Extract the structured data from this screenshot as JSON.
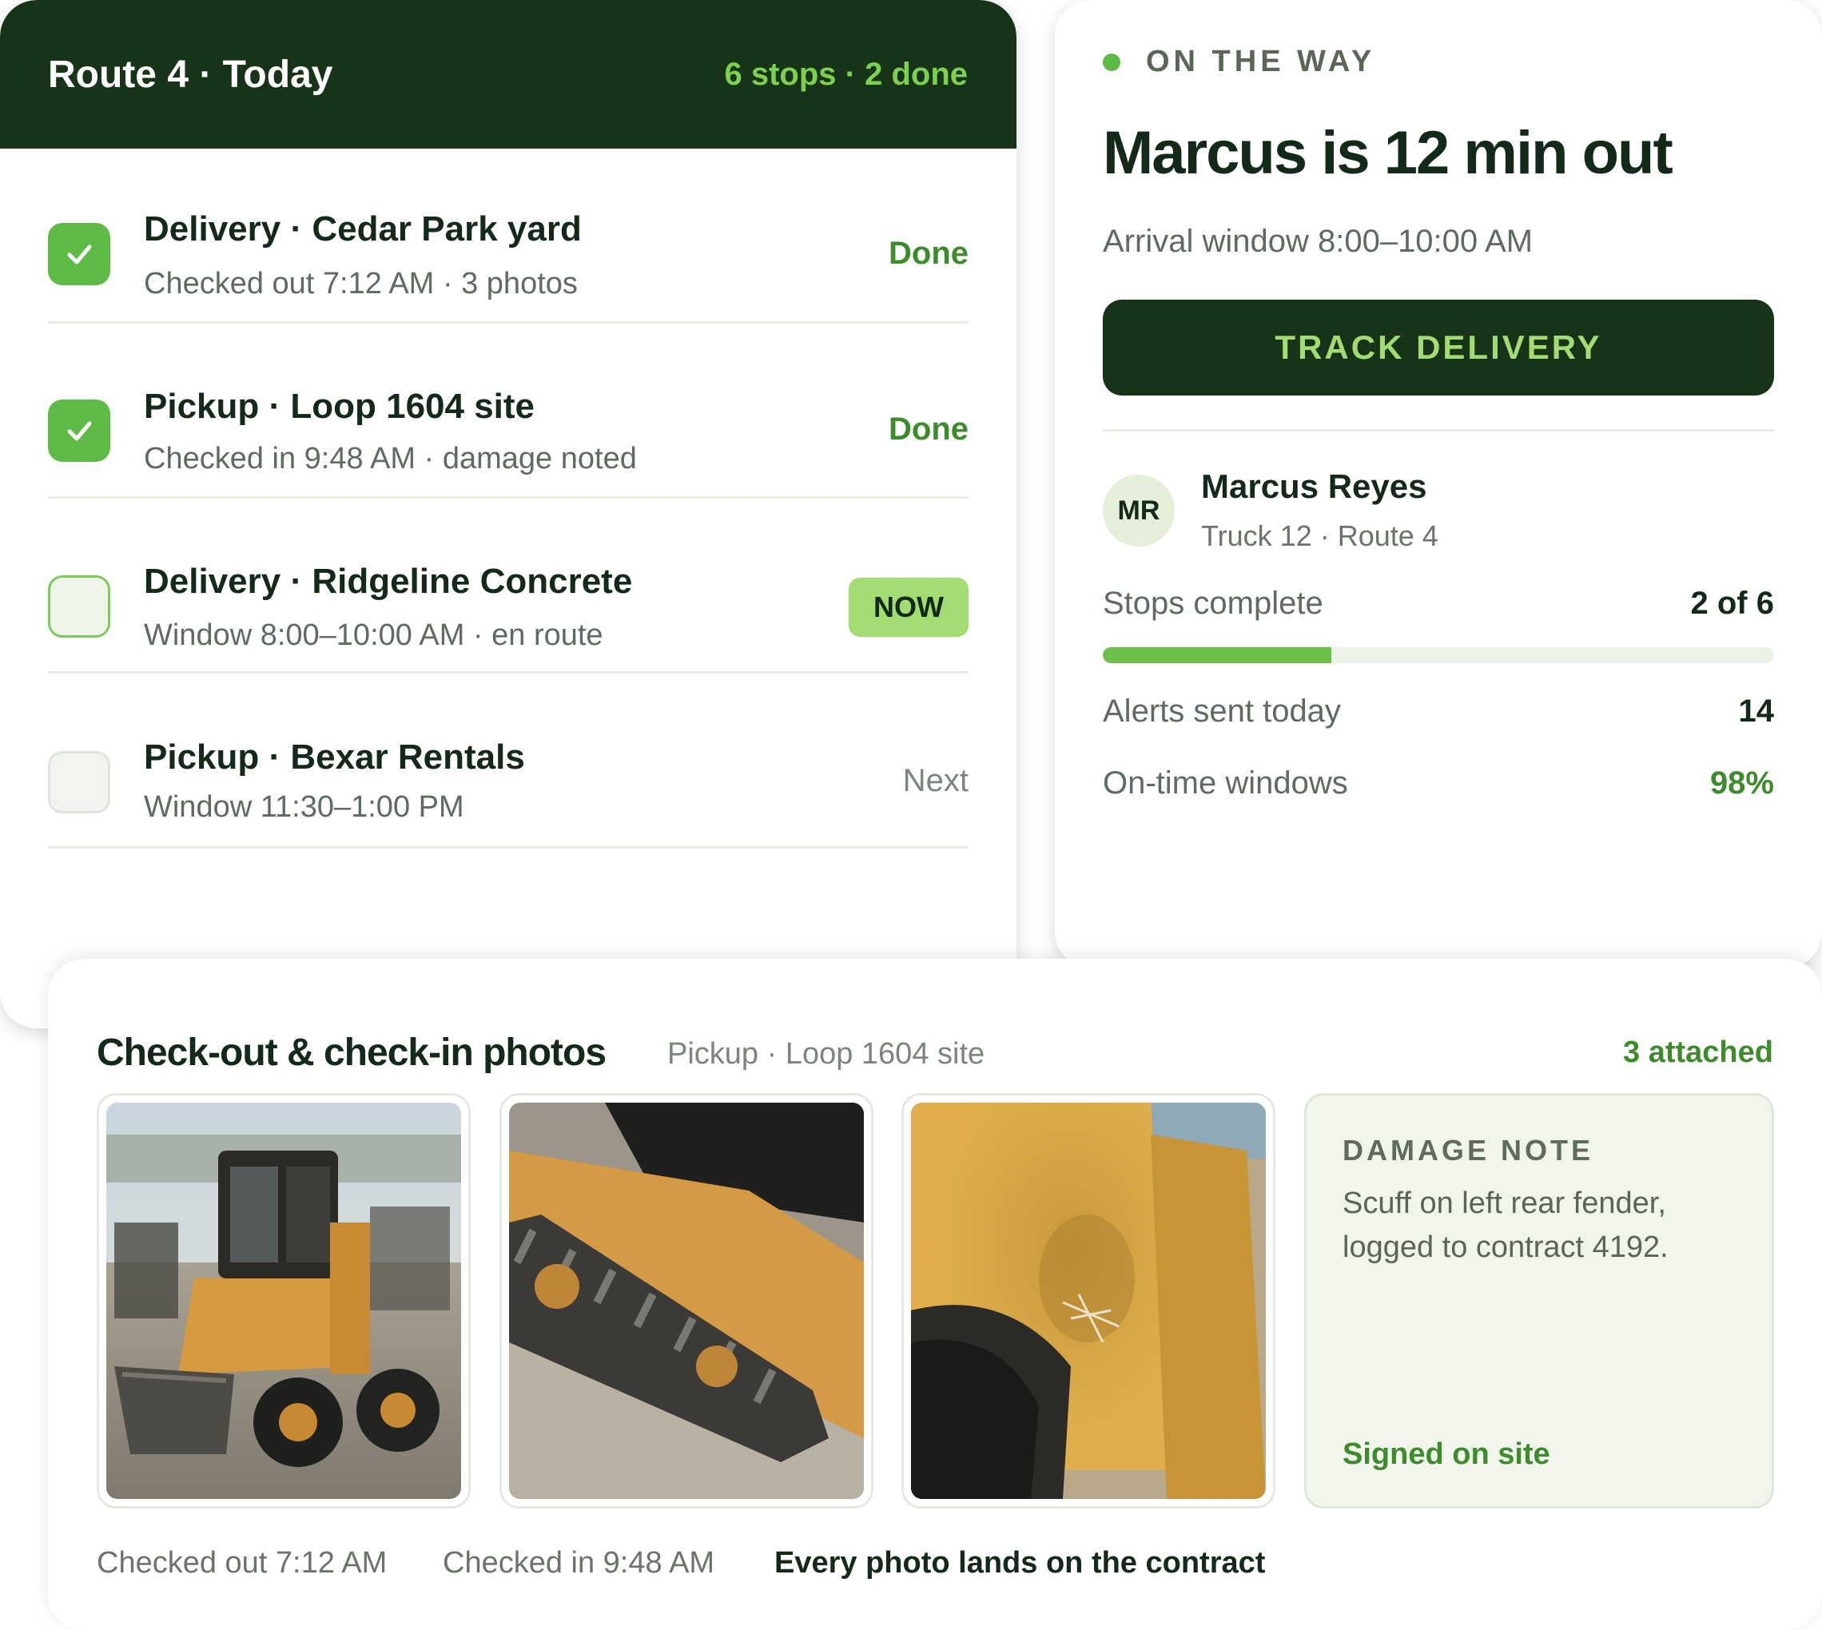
{
  "route": {
    "title": "Route 4 · Today",
    "summary": "6 stops · 2 done",
    "stops": [
      {
        "title": "Delivery · Cedar Park yard",
        "subtitle": "Checked out 7:12 AM · 3 photos",
        "status": "Done",
        "state": "done"
      },
      {
        "title": "Pickup · Loop 1604 site",
        "subtitle": "Checked in 9:48 AM · damage noted",
        "status": "Done",
        "state": "done"
      },
      {
        "title": "Delivery · Ridgeline Concrete",
        "subtitle": "Window 8:00–10:00 AM · en route",
        "status": "NOW",
        "state": "current"
      },
      {
        "title": "Pickup · Bexar Rentals",
        "subtitle": "Window 11:30–1:00 PM",
        "status": "Next",
        "state": "pending"
      }
    ]
  },
  "tracking": {
    "status": "ON THE WAY",
    "headline": "Marcus is 12 min out",
    "arrival_window": "Arrival window 8:00–10:00 AM",
    "button_label": "TRACK DELIVERY",
    "driver": {
      "initials": "MR",
      "name": "Marcus Reyes",
      "meta": "Truck 12 · Route 4"
    },
    "metrics": {
      "stops_label": "Stops complete",
      "stops_value": "2 of 6",
      "stops_progress": 0.34,
      "alerts_label": "Alerts sent today",
      "alerts_value": "14",
      "ontime_label": "On-time windows",
      "ontime_value": "98%"
    }
  },
  "photos": {
    "title": "Check-out & check-in photos",
    "context": "Pickup · Loop 1604 site",
    "count": "3 attached",
    "items": [
      {
        "name": "skid-steer-loader-photo"
      },
      {
        "name": "rubber-track-photo"
      },
      {
        "name": "dented-fender-photo"
      }
    ],
    "damage_note": {
      "label": "DAMAGE NOTE",
      "text": "Scuff on left rear fender, logged to contract 4192.",
      "footer": "Signed on site"
    },
    "captions": {
      "checked_out": "Checked out 7:12 AM",
      "checked_in": "Checked in 9:48 AM",
      "tagline": "Every photo lands on the contract"
    }
  },
  "colors": {
    "dark_green": "#173318",
    "accent_green": "#5dbb45",
    "lime": "#a3dc72",
    "text_green": "#3d8c2c"
  }
}
